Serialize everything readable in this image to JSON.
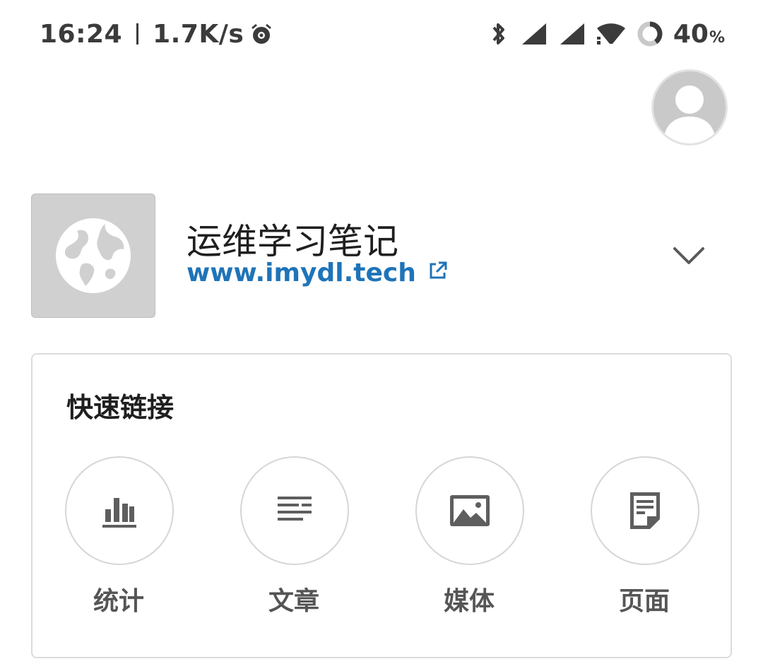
{
  "status_bar": {
    "time": "16:24",
    "network_speed": "1.7K/s",
    "battery_level": "40",
    "battery_unit": "%",
    "icons": [
      "alarm-icon",
      "bluetooth-icon",
      "signal-icon",
      "signal-icon",
      "wifi-icon",
      "battery-icon"
    ]
  },
  "site": {
    "title": "运维学习笔记",
    "url": "www.imydl.tech",
    "icon": "globe-icon"
  },
  "quick_links": {
    "title": "快速链接",
    "items": [
      {
        "label": "统计",
        "icon": "stats-icon"
      },
      {
        "label": "文章",
        "icon": "posts-icon"
      },
      {
        "label": "媒体",
        "icon": "media-icon"
      },
      {
        "label": "页面",
        "icon": "pages-icon"
      }
    ]
  },
  "colors": {
    "link": "#1f74b8",
    "text": "#1f1f1f",
    "icon_gray": "#5e5e5e",
    "placeholder_gray": "#d0d0d0"
  }
}
